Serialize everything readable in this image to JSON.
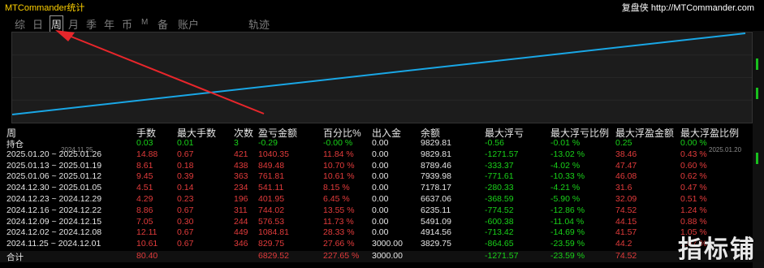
{
  "app": {
    "title": "MTCommander统计",
    "brand": "复盘侠 http://MTCommander.com"
  },
  "tabs": [
    "综",
    "日",
    "周",
    "月",
    "季",
    "年",
    "币",
    "M",
    "备",
    "账户",
    "轨迹"
  ],
  "active_tab": "周",
  "chart_data": {
    "type": "line",
    "x": [
      "2024.11.25",
      "2025.01.20"
    ],
    "values": [
      3829.75,
      9829.81
    ],
    "x_tick_labels": [
      "2024.11.25",
      "2025.01.20"
    ],
    "line_color": "#19a7e6"
  },
  "table": {
    "headers": [
      "周",
      "手数",
      "最大手数",
      "次数",
      "盈亏金额",
      "百分比%",
      "出入金",
      "余额",
      "最大浮亏",
      "最大浮亏比例",
      "最大浮盈金额",
      "最大浮盈比例"
    ],
    "rows": [
      [
        "持仓",
        "0.03",
        "0.01",
        "3",
        "-0.29",
        "-0.00 %",
        "0.00",
        "9829.81",
        "-0.56",
        "-0.01 %",
        "0.25",
        "0.00 %"
      ],
      [
        "2025.01.20 ~ 2025.01.26",
        "14.88",
        "0.67",
        "421",
        "1040.35",
        "11.84 %",
        "0.00",
        "9829.81",
        "-1271.57",
        "-13.02 %",
        "38.46",
        "0.43 %"
      ],
      [
        "2025.01.13 ~ 2025.01.19",
        "8.61",
        "0.18",
        "438",
        "849.48",
        "10.70 %",
        "0.00",
        "8789.46",
        "-333.37",
        "-4.02 %",
        "47.47",
        "0.60 %"
      ],
      [
        "2025.01.06 ~ 2025.01.12",
        "9.45",
        "0.39",
        "363",
        "761.81",
        "10.61 %",
        "0.00",
        "7939.98",
        "-771.61",
        "-10.33 %",
        "46.08",
        "0.62 %"
      ],
      [
        "2024.12.30 ~ 2025.01.05",
        "4.51",
        "0.14",
        "234",
        "541.11",
        "8.15 %",
        "0.00",
        "7178.17",
        "-280.33",
        "-4.21 %",
        "31.6",
        "0.47 %"
      ],
      [
        "2024.12.23 ~ 2024.12.29",
        "4.29",
        "0.23",
        "196",
        "401.95",
        "6.45 %",
        "0.00",
        "6637.06",
        "-368.59",
        "-5.90 %",
        "32.09",
        "0.51 %"
      ],
      [
        "2024.12.16 ~ 2024.12.22",
        "8.86",
        "0.67",
        "311",
        "744.02",
        "13.55 %",
        "0.00",
        "6235.11",
        "-774.52",
        "-12.86 %",
        "74.52",
        "1.24 %"
      ],
      [
        "2024.12.09 ~ 2024.12.15",
        "7.05",
        "0.30",
        "244",
        "576.53",
        "11.73 %",
        "0.00",
        "5491.09",
        "-600.38",
        "-11.04 %",
        "44.15",
        "0.88 %"
      ],
      [
        "2024.12.02 ~ 2024.12.08",
        "12.11",
        "0.67",
        "449",
        "1084.81",
        "28.33 %",
        "0.00",
        "4914.56",
        "-713.42",
        "-14.69 %",
        "41.57",
        "1.05 %"
      ],
      [
        "2024.11.25 ~ 2024.12.01",
        "10.61",
        "0.67",
        "346",
        "829.75",
        "27.66 %",
        "3000.00",
        "3829.75",
        "-864.65",
        "-23.59 %",
        "44.2",
        "1.07 %"
      ],
      [
        "合计",
        "80.40",
        "",
        "",
        "6829.52",
        "227.65 %",
        "3000.00",
        "",
        "-1271.57",
        "-23.59 %",
        "74.52",
        ""
      ]
    ]
  },
  "colors": {
    "yellow": "#ffd100",
    "red": "#e23b3b",
    "green": "#19d219",
    "white": "#e6e6e6",
    "arrow": "#e8262b"
  },
  "watermark": "指标铺"
}
